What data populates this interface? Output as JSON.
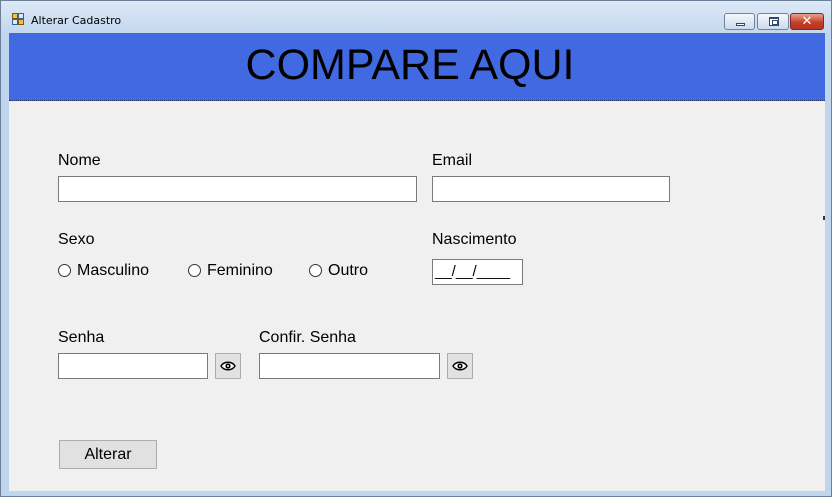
{
  "window": {
    "title": "Alterar Cadastro",
    "close_glyph": "✕"
  },
  "banner": {
    "title": "COMPARE AQUI",
    "color": "#4169e1"
  },
  "form": {
    "nome_label": "Nome",
    "nome_value": "",
    "email_label": "Email",
    "email_value": "",
    "sexo_label": "Sexo",
    "sexo_options": [
      "Masculino",
      "Feminino",
      "Outro"
    ],
    "nascimento_label": "Nascimento",
    "nascimento_mask": "__/__/____",
    "senha_label": "Senha",
    "senha_value": "",
    "confir_senha_label": "Confir. Senha",
    "confir_senha_value": "",
    "alterar_label": "Alterar"
  },
  "icons": {
    "window": "app-icon",
    "reveal": "eye-icon"
  }
}
